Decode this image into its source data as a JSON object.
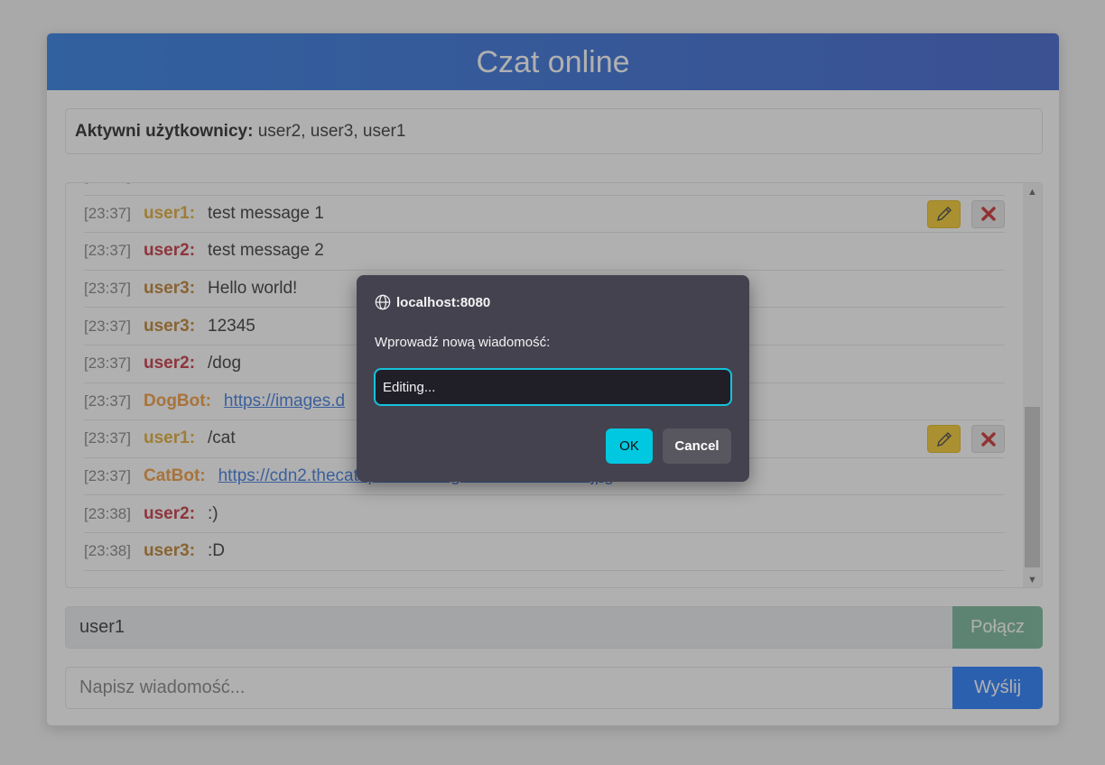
{
  "header": {
    "title": "Czat online"
  },
  "active_users": {
    "label": "Aktywni użytkownicy:",
    "list": "user2, user3, user1"
  },
  "messages": [
    {
      "time": "[23:37]",
      "user": "user1:",
      "text": "test message 1",
      "user_class": "u1",
      "own": true
    },
    {
      "time": "[23:37]",
      "user": "user2:",
      "text": "test message 2",
      "user_class": "u2"
    },
    {
      "time": "[23:37]",
      "user": "user3:",
      "text": "Hello world!",
      "user_class": "u3"
    },
    {
      "time": "[23:37]",
      "user": "user3:",
      "text": "12345",
      "user_class": "u3"
    },
    {
      "time": "[23:37]",
      "user": "user2:",
      "text": "/dog",
      "user_class": "u2"
    },
    {
      "time": "[23:37]",
      "user": "DogBot:",
      "link": "https://images.d",
      "user_class": "bot"
    },
    {
      "time": "[23:37]",
      "user": "user1:",
      "text": "/cat",
      "user_class": "u1",
      "own": true
    },
    {
      "time": "[23:37]",
      "user": "CatBot:",
      "link": "https://cdn2.thecatapi.com/images/MTc0MzIxMw.jpg",
      "user_class": "bot"
    },
    {
      "time": "[23:38]",
      "user": "user2:",
      "text": ":)",
      "user_class": "u2"
    },
    {
      "time": "[23:38]",
      "user": "user3:",
      "text": ":D",
      "user_class": "u3"
    }
  ],
  "connect": {
    "username_value": "user1",
    "button_label": "Połącz"
  },
  "compose": {
    "placeholder": "Napisz wiadomość...",
    "button_label": "Wyślij"
  },
  "dialog": {
    "origin": "localhost:8080",
    "message": "Wprowadź nową wiadomość:",
    "input_value": "Editing...",
    "ok_label": "OK",
    "cancel_label": "Cancel"
  },
  "colors": {
    "header_gradient_start": "#1a6fe0",
    "header_gradient_end": "#2a52c8",
    "dialog_accent": "#00c8e0",
    "user1": "#e0a322",
    "user2": "#c0202e",
    "user3": "#b8741a",
    "bot": "#f0902a"
  }
}
